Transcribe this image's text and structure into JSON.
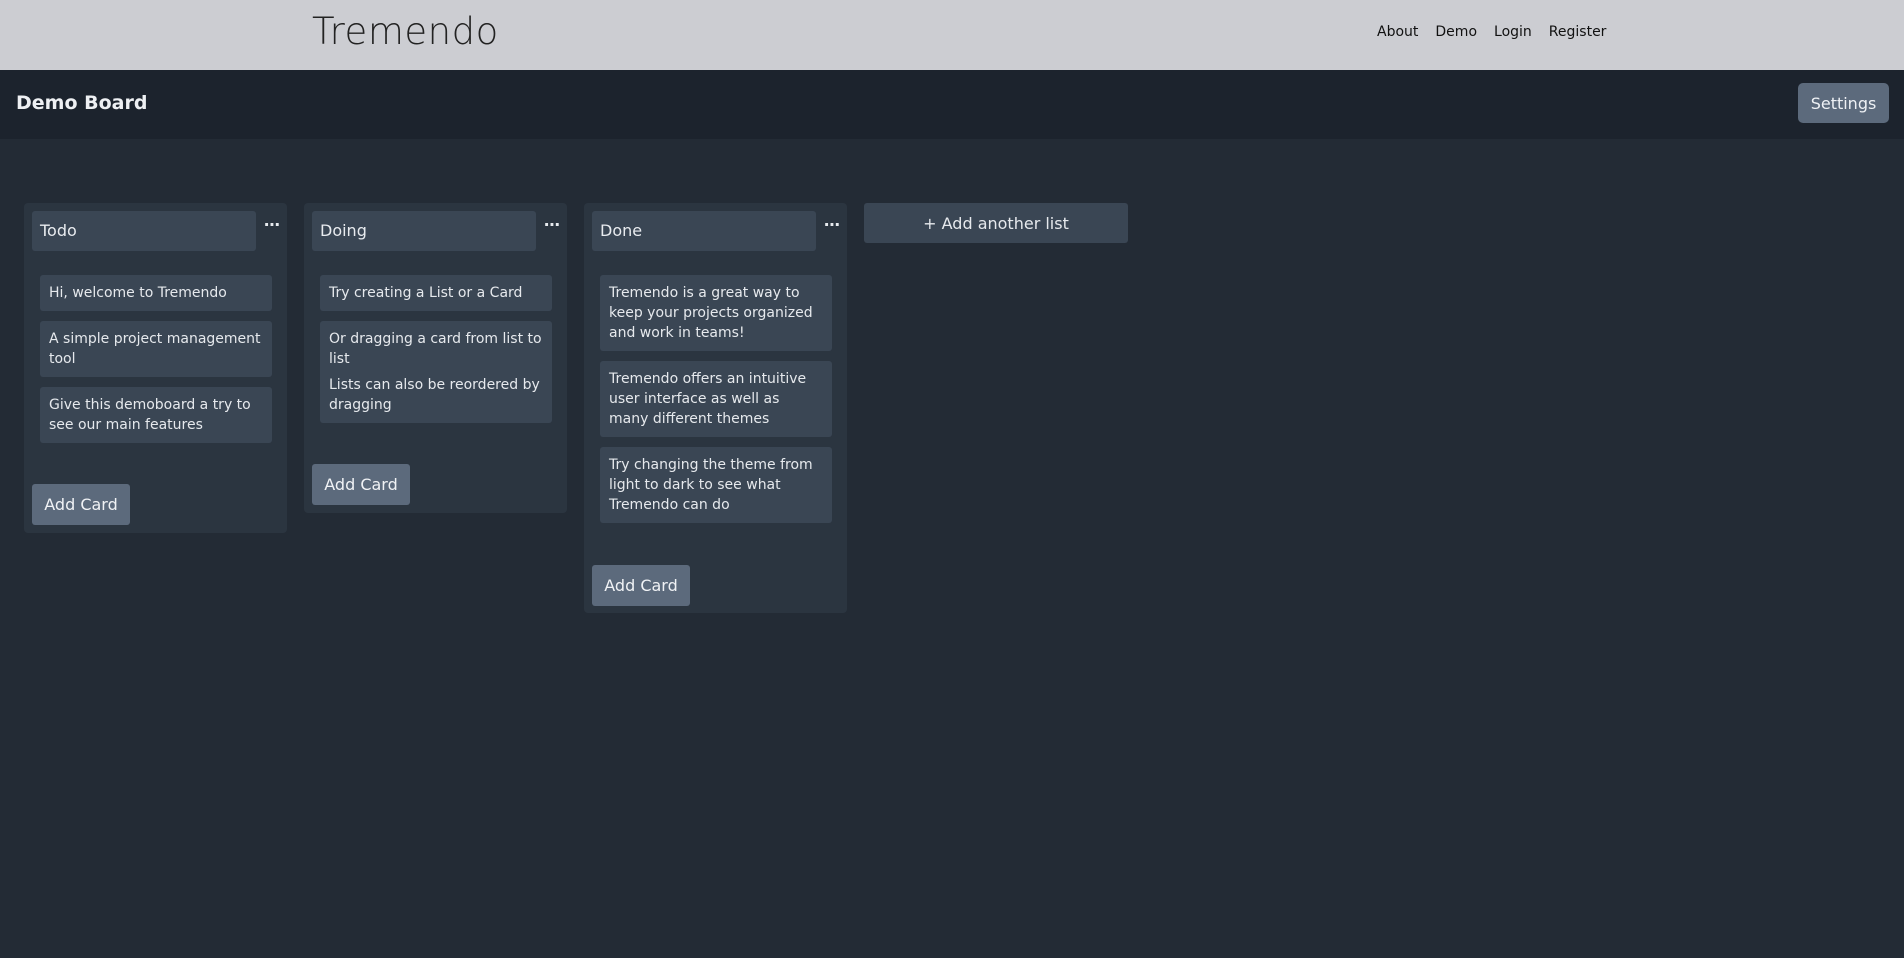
{
  "nav": {
    "brand": "Tremendo",
    "links": [
      "About",
      "Demo",
      "Login",
      "Register"
    ]
  },
  "board": {
    "title": "Demo Board",
    "settings_label": "Settings",
    "add_list_label": "+ Add another list",
    "menu_glyph": "⋯",
    "lists": [
      {
        "title": "Todo",
        "cards": [
          "Hi, welcome to Tremendo",
          "A simple project management tool",
          "Give this demoboard a try to see our main features"
        ],
        "add_card_label": "Add Card"
      },
      {
        "title": "Doing",
        "cards": [
          "Try creating a List or a Card",
          "Or dragging a card from list to list",
          "Lists can also be reordered by dragging"
        ],
        "add_card_label": "Add Card"
      },
      {
        "title": "Done",
        "cards": [
          "Tremendo is a great way to keep your projects organized and work in teams!",
          "Tremendo offers an intuitive user interface as well as many different themes",
          "Try changing the theme from light to dark to see what Tremendo can do"
        ],
        "add_card_label": "Add Card"
      }
    ]
  },
  "colors": {
    "nav_bg": "#cccdd2",
    "boardbar_bg": "#1c232d",
    "page_bg": "#232b35",
    "list_bg": "#2b3540",
    "card_bg": "#3a4654",
    "button_bg": "#5c6a7c"
  },
  "icons": {
    "list_menu": "more-horizontal-icon"
  }
}
